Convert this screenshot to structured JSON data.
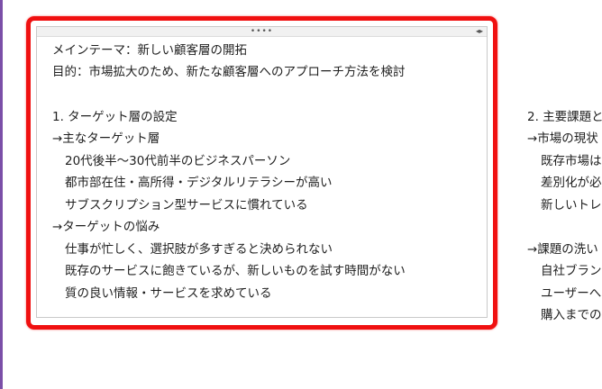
{
  "note1": {
    "drag_handle": "••••",
    "resize_handle": "◂▸",
    "lines": [
      "メインテーマ：新しい顧客層の開拓",
      "目的：市場拡大のため、新たな顧客層へのアプローチ方法を検討",
      "1. ターゲット層の設定",
      "→主なターゲット層",
      "20代後半〜30代前半のビジネスパーソン",
      "都市部在住・高所得・デジタルリテラシーが高い",
      "サブスクリプション型サービスに慣れている",
      "→ターゲットの悩み",
      "仕事が忙しく、選択肢が多すぎると決められない",
      "既存のサービスに飽きているが、新しいものを試す時間がない",
      "質の良い情報・サービスを求めている"
    ]
  },
  "note2": {
    "lines": [
      "2. 主要課題と",
      "→市場の現状",
      "既存市場は",
      "差別化が必",
      "新しいトレ",
      "→課題の洗い",
      "自社ブラン",
      "ユーザーへ",
      "購入までの"
    ]
  },
  "colors": {
    "highlight": "#f01010",
    "left_rule": "#7b4fa8"
  }
}
